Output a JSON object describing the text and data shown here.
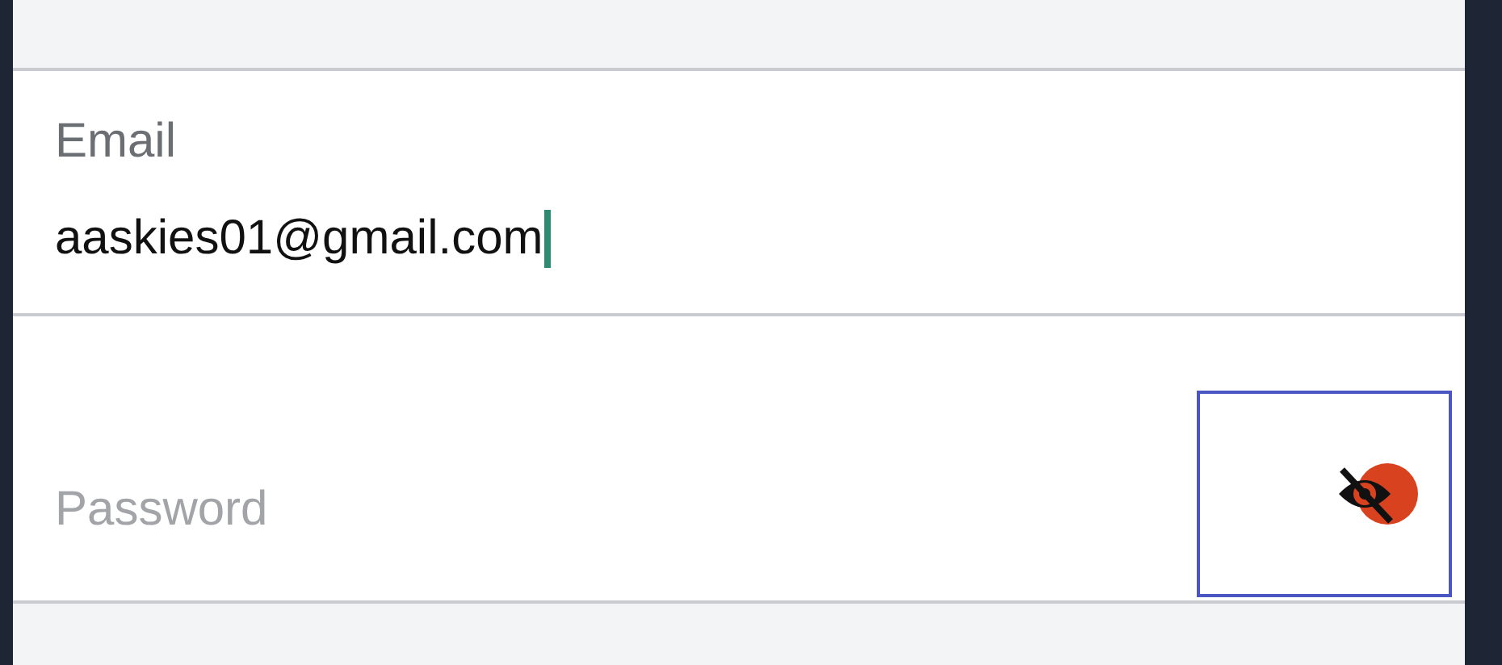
{
  "email": {
    "label": "Email",
    "value": "aaskies01@gmail.com",
    "focused": true
  },
  "password": {
    "placeholder": "Password",
    "toggle_focused": true
  }
}
